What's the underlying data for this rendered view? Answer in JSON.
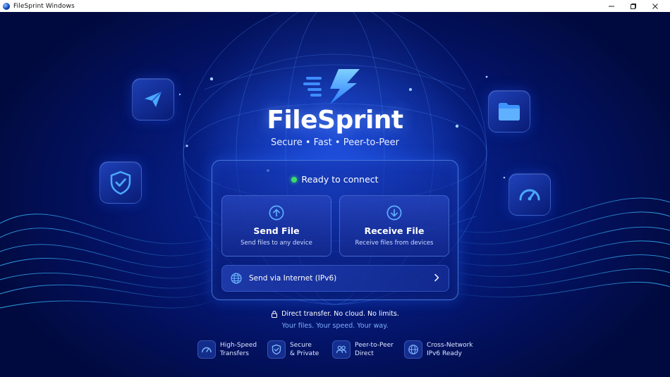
{
  "window": {
    "title": "FileSprint Windows"
  },
  "brand": {
    "name": "FileSprint",
    "tagline": "Secure • Fast • Peer-to-Peer"
  },
  "status": {
    "text": "Ready to connect",
    "color": "#3ddc6a"
  },
  "actions": {
    "send": {
      "title": "Send File",
      "subtitle": "Send files to any device",
      "icon": "arrow-up-circle-icon"
    },
    "receive": {
      "title": "Receive File",
      "subtitle": "Receive files from devices",
      "icon": "arrow-down-circle-icon"
    },
    "internet": {
      "label": "Send via Internet (IPv6)",
      "icon": "globe-icon"
    }
  },
  "notice": {
    "line1": "Direct transfer. No cloud. No limits.",
    "line2": "Your files. Your speed. Your way."
  },
  "features": [
    {
      "line1": "High-Speed",
      "line2": "Transfers",
      "icon": "speedometer-icon"
    },
    {
      "line1": "Secure",
      "line2": "& Private",
      "icon": "shield-icon"
    },
    {
      "line1": "Peer-to-Peer",
      "line2": "Direct",
      "icon": "users-icon"
    },
    {
      "line1": "Cross-Network",
      "line2": "IPv6 Ready",
      "icon": "globe-icon"
    }
  ],
  "decor_icons": [
    "paper-plane-icon",
    "shield-check-icon",
    "folder-icon",
    "speedometer-icon"
  ],
  "colors": {
    "accent": "#4aa8ff",
    "background": "#061f86",
    "status_green": "#3ddc6a",
    "link": "#7eb0ff"
  }
}
